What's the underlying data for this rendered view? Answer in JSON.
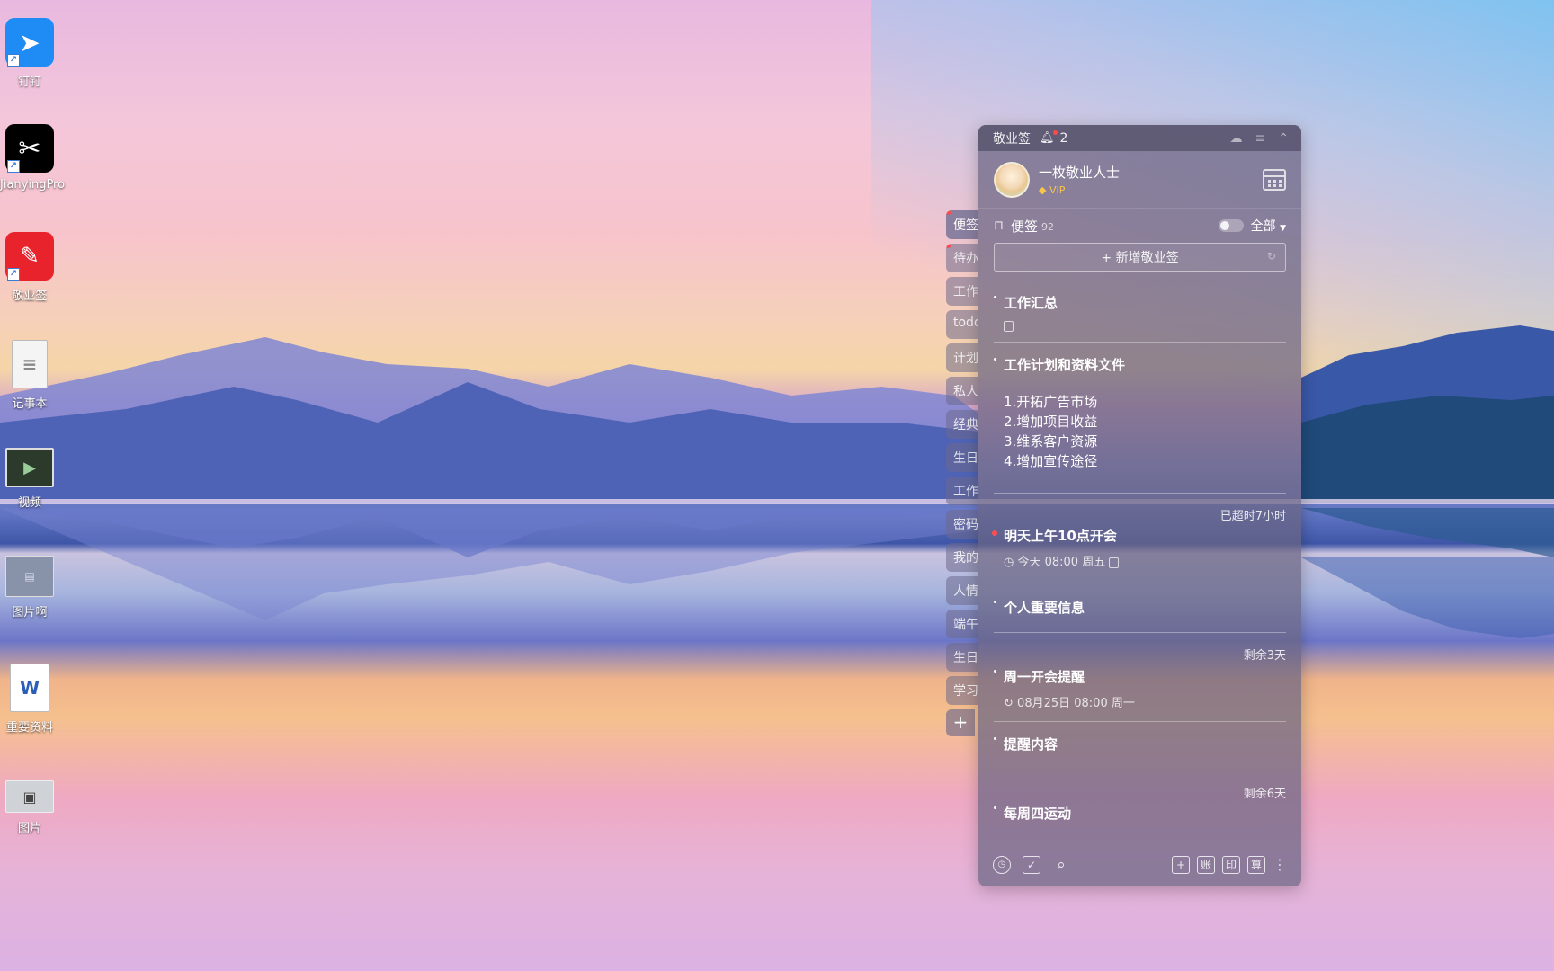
{
  "desktop": {
    "icons": [
      {
        "label": "钉钉",
        "name": "dingtalk"
      },
      {
        "label": "JianyingPro",
        "name": "jianying"
      },
      {
        "label": "敬业签",
        "name": "jingyeqian"
      },
      {
        "label": "记事本",
        "name": "notepad"
      },
      {
        "label": "视频",
        "name": "video"
      },
      {
        "label": "图片啊",
        "name": "image-a"
      },
      {
        "label": "重要资料",
        "name": "word-doc"
      },
      {
        "label": "图片",
        "name": "image"
      }
    ]
  },
  "side_tabs": [
    "便签",
    "待办",
    "工作",
    "todo",
    "计划",
    "私人",
    "经典",
    "生日",
    "工作",
    "密码",
    "我的",
    "人情",
    "端午",
    "生日",
    "学习"
  ],
  "side_add": "+",
  "panel": {
    "app_title": "敬业签",
    "notification_count": "2",
    "user_name": "一枚敬业人士",
    "vip_label": "VIP",
    "filter_label": "便签",
    "filter_count": "92",
    "filter_scope": "全部",
    "new_button": "+ 新增敬业签",
    "notes": [
      {
        "title": "工作汇总"
      },
      {
        "title": "工作计划和资料文件",
        "body": [
          "1.开拓广告市场",
          "2.增加项目收益",
          "3.维系客户资源",
          "4.增加宣传途径"
        ]
      },
      {
        "status": "已超时7小时",
        "title": "明天上午10点开会",
        "meta": "今天 08:00 周五"
      },
      {
        "title": "个人重要信息"
      },
      {
        "status": "剩余3天",
        "title": "周一开会提醒",
        "meta": "08月25日 08:00 周一"
      },
      {
        "title": "提醒内容"
      },
      {
        "status": "剩余6天",
        "title": "每周四运动"
      }
    ],
    "footer": {
      "btn_add": "+",
      "btn_account": "账",
      "btn_print": "印",
      "btn_calc": "算"
    }
  }
}
